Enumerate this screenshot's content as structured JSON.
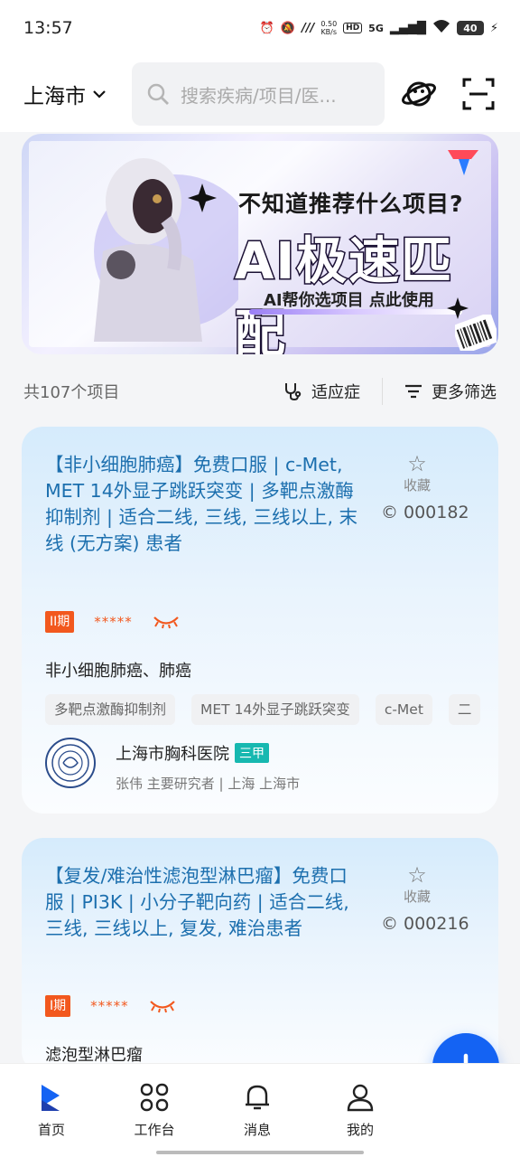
{
  "status_bar": {
    "time": "13:57",
    "net_speed_value": "0.50",
    "net_speed_unit": "KB/s",
    "hd": "HD",
    "signal": "5G",
    "battery": "40"
  },
  "header": {
    "city": "上海市",
    "search_placeholder": "搜索疾病/项目/医..."
  },
  "banner": {
    "question": "不知道推荐什么项目?",
    "headline": "AI极速匹配",
    "subtitle": "AI帮你选项目 点此使用"
  },
  "filter": {
    "total": "共107个项目",
    "indication_label": "适应症",
    "more_filter_label": "更多筛选"
  },
  "cards": [
    {
      "title": "【非小细胞肺癌】免费口服 | c-Met, MET 14外显子跳跃突变 | 多靶点激酶抑制剂 | 适合二线, 三线, 三线以上, 末线 (无方案) 患者",
      "fav_label": "收藏",
      "number": "000182",
      "phase": "II期",
      "stars": "*****",
      "disease": "非小细胞肺癌、肺癌",
      "tags": [
        "多靶点激酶抑制剂",
        "MET 14外显子跳跃突变",
        "c-Met",
        "二"
      ],
      "hospital": {
        "name": "上海市胸科医院",
        "grade": "三甲",
        "detail": "张伟  主要研究者  |  上海  上海市"
      }
    },
    {
      "title": "【复发/难治性滤泡型淋巴瘤】免费口服 | PI3K | 小分子靶向药 | 适合二线, 三线, 三线以上, 复发, 难治患者",
      "fav_label": "收藏",
      "number": "000216",
      "phase": "I期",
      "stars": "*****",
      "disease": "滤泡型淋巴瘤"
    }
  ],
  "nav": {
    "home": "首页",
    "workbench": "工作台",
    "messages": "消息",
    "mine": "我的"
  },
  "colors": {
    "accent": "#1463f3",
    "title_blue": "#1c6fae",
    "phase_orange": "#f2581e",
    "grade_teal": "#17b8b0"
  }
}
